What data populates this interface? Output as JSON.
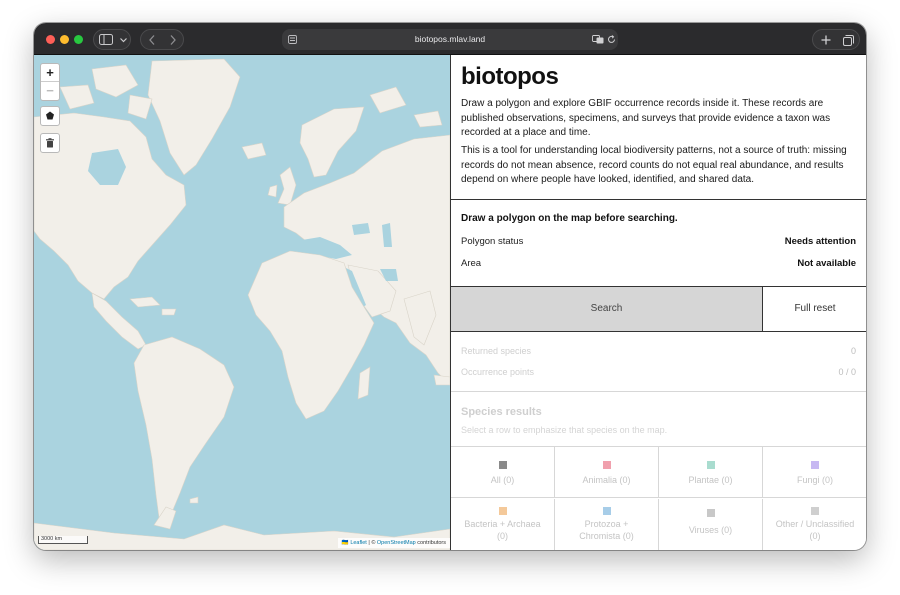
{
  "browser": {
    "url": "biotopos.mlav.land",
    "icons": {
      "sidebar": "sidebar-icon",
      "back": "chevron-left-icon",
      "forward": "chevron-right-icon",
      "translate": "translate-icon",
      "reload": "reload-icon",
      "new_tab": "plus-icon",
      "tabs": "tabs-overview-icon"
    }
  },
  "map": {
    "zoom_in": "+",
    "zoom_out": "−",
    "scale": "3000 km",
    "attribution": {
      "flag": "🇺🇦",
      "leaflet": "Leaflet",
      "separator": " | © ",
      "osm": "OpenStreetMap",
      "suffix": " contributors"
    },
    "colors": {
      "water": "#aad3df",
      "land": "#f2efe9"
    }
  },
  "panel": {
    "title": "biotopos",
    "intro_1": "Draw a polygon and explore GBIF occurrence records inside it. These records are published observations, specimens, and surveys that provide evidence a taxon was recorded at a place and time.",
    "intro_2": "This is a tool for understanding local biodiversity patterns, not a source of truth: missing records do not mean absence, record counts do not equal real abundance, and results depend on where people have looked, identified, and shared data.",
    "status": {
      "heading": "Draw a polygon on the map before searching.",
      "polygon_label": "Polygon status",
      "polygon_value": "Needs attention",
      "area_label": "Area",
      "area_value": "Not available"
    },
    "buttons": {
      "search": "Search",
      "reset": "Full reset"
    },
    "stats": {
      "species_label": "Returned species",
      "species_value": "0",
      "points_label": "Occurrence points",
      "points_value": "0 / 0"
    },
    "results": {
      "title": "Species results",
      "subtitle": "Select a row to emphasize that species on the map."
    },
    "filters": [
      {
        "label": "All (0)",
        "color": "#8a8a8a"
      },
      {
        "label": "Animalia (0)",
        "color": "#f0a0ad"
      },
      {
        "label": "Plantae (0)",
        "color": "#a9dccf"
      },
      {
        "label": "Fungi (0)",
        "color": "#c7b8f2"
      },
      {
        "label": "Bacteria + Archaea",
        "label2": "(0)",
        "color": "#f4c99a"
      },
      {
        "label": "Protozoa +",
        "label2": "Chromista (0)",
        "color": "#a7cde8"
      },
      {
        "label": "Viruses (0)",
        "color": "#c8c8c8"
      },
      {
        "label": "Other / Unclassified",
        "label2": "(0)",
        "color": "#cfcfcf"
      }
    ]
  }
}
